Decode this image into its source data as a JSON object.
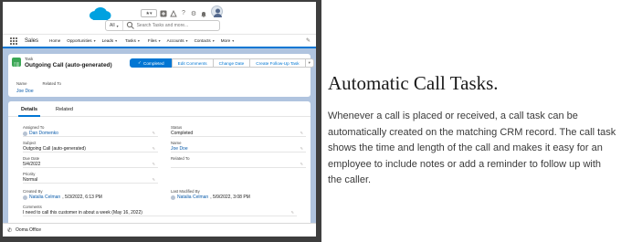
{
  "header": {
    "search_scope": "All",
    "search_placeholder": "Search Tasks and more..."
  },
  "nav": {
    "app_name": "Sales",
    "items": [
      {
        "label": "Home",
        "dropdown": false
      },
      {
        "label": "Opportunities",
        "dropdown": true
      },
      {
        "label": "Leads",
        "dropdown": true
      },
      {
        "label": "Tasks",
        "dropdown": true,
        "active": true
      },
      {
        "label": "Files",
        "dropdown": true
      },
      {
        "label": "Accounts",
        "dropdown": true
      },
      {
        "label": "Contacts",
        "dropdown": true
      },
      {
        "label": "More",
        "dropdown": true
      }
    ]
  },
  "record": {
    "type_label": "Task",
    "title": "Outgoing Call (auto-generated)",
    "buttons": {
      "completed": "Completed",
      "edit_comments": "Edit Comments",
      "change_date": "Change Date",
      "create_follow_up": "Create Follow-Up Task"
    },
    "highlights": {
      "name_label": "Name",
      "related_label": "Related To",
      "name_value": "Joe Doe"
    }
  },
  "details": {
    "tabs": [
      "Details",
      "Related"
    ],
    "left_fields": [
      {
        "label": "Assigned To",
        "value": "Dan Domenko",
        "link": true,
        "user": true
      },
      {
        "label": "Subject",
        "value": "Outgoing Call (auto-generated)",
        "link": false
      },
      {
        "label": "Due Date",
        "value": "5/4/2022",
        "link": false
      },
      {
        "label": "Priority",
        "value": "Normal",
        "link": false
      },
      {
        "label": "Created By",
        "value": "Natalia Celman",
        "suffix": ", 5/3/2022, 6:13 PM",
        "link": true,
        "user": true
      },
      {
        "label": "Comments",
        "value": "I need to call this customer in about a week (May 16, 2022)",
        "link": false
      }
    ],
    "right_fields": [
      {
        "label": "Status",
        "value": "Completed",
        "link": false
      },
      {
        "label": "Name",
        "value": "Joe Doe",
        "link": true
      },
      {
        "label": "Related To",
        "value": "",
        "link": false
      },
      {
        "label": "Last Modified By",
        "value": "Natalia Celman",
        "suffix": ", 5/9/2022, 3:08 PM",
        "link": true,
        "user": true
      }
    ]
  },
  "utility": {
    "label": "Ooma Office"
  },
  "article": {
    "heading": "Automatic Call Tasks.",
    "body": "Whenever a call is placed or received, a call task can be automatically created on the matching CRM record. The call task shows the time and length of the call and makes it easy for an employee to include notes or add a reminder to follow up with the caller."
  },
  "colors": {
    "brand_blue": "#0176d3",
    "link_blue": "#0b5cab",
    "task_green": "#3ba755",
    "page_bg": "#b0c4df",
    "frame": "#3e3e3e"
  }
}
